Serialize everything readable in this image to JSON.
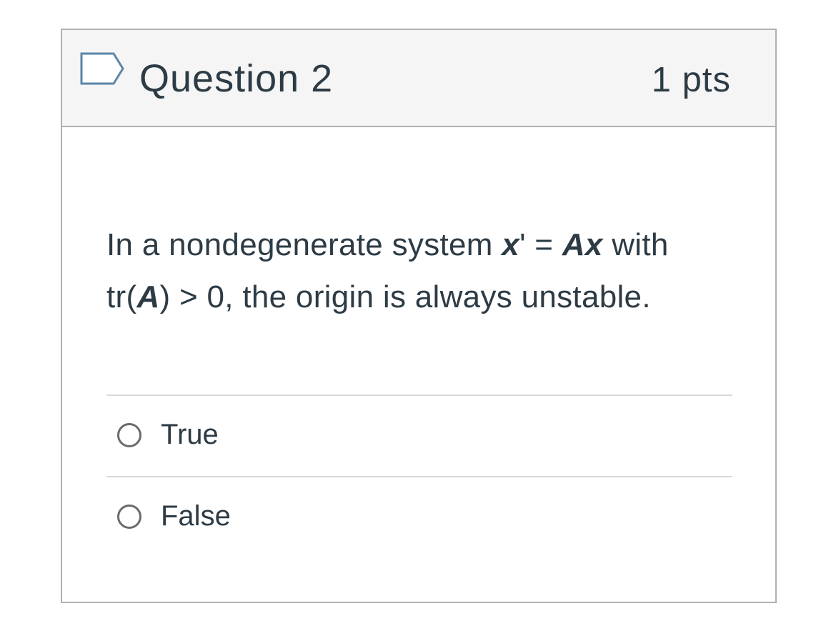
{
  "question": {
    "title": "Question 2",
    "points": "1 pts",
    "text": {
      "part1": "In a nondegenerate system ",
      "var_x": "x",
      "part2": "' = ",
      "var_A": "A",
      "var_x2": "x",
      "part3": " with tr(",
      "var_A2": "A",
      "part4": ") > 0, the origin is always unstable."
    }
  },
  "answers": [
    {
      "label": "True",
      "selected": false
    },
    {
      "label": "False",
      "selected": false
    }
  ],
  "icons": {
    "flag": "bookmark-flag-icon",
    "radio": "radio-button-icon"
  },
  "colors": {
    "text": "#2d3b45",
    "header_bg": "#f5f5f5",
    "border": "#b0b0b0",
    "flag_stroke": "#5a86a8"
  }
}
